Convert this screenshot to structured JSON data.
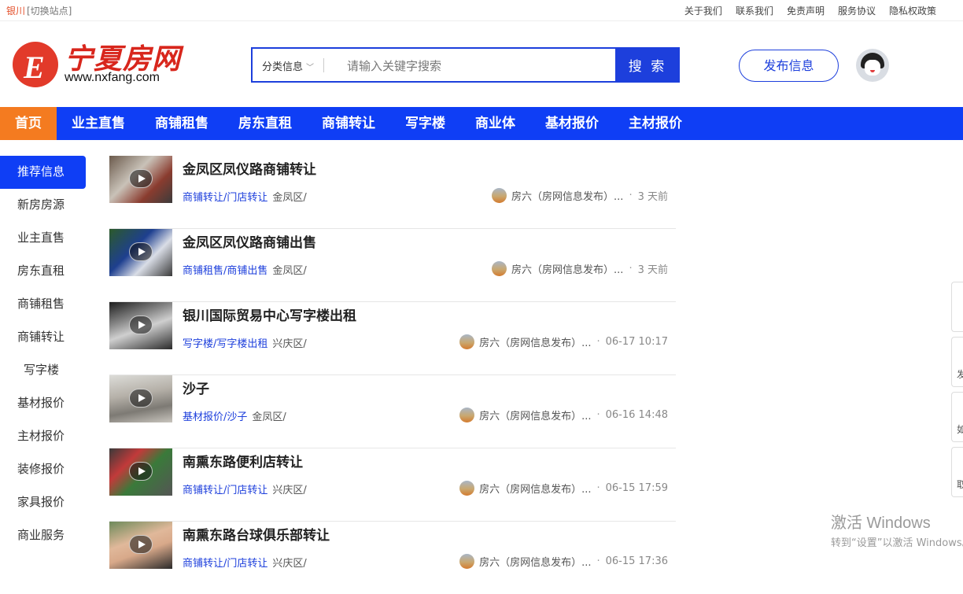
{
  "topbar": {
    "city": "银川",
    "switch": "[切换站点]",
    "links": [
      "关于我们",
      "联系我们",
      "免责声明",
      "服务协议",
      "隐私权政策"
    ]
  },
  "logo": {
    "title": "宁夏房网",
    "url": "www.nxfang.com",
    "mark": "E"
  },
  "search": {
    "category": "分类信息",
    "placeholder": "请输入关键字搜索",
    "button": "搜 索"
  },
  "header": {
    "publish": "发布信息"
  },
  "nav": [
    "首页",
    "业主直售",
    "商铺租售",
    "房东直租",
    "商铺转让",
    "写字楼",
    "商业体",
    "基材报价",
    "主材报价"
  ],
  "sidebar": [
    "推荐信息",
    "新房房源",
    "业主直售",
    "房东直租",
    "商铺租售",
    "商铺转让",
    "写字楼",
    "基材报价",
    "主材报价",
    "装修报价",
    "家具报价",
    "商业服务"
  ],
  "listings": [
    {
      "title": "金凤区凤仪路商铺转让",
      "tag": "商铺转让/门店转让",
      "district": "金凤区/",
      "author": "房六（房网信息发布）...",
      "time": "3 天前"
    },
    {
      "title": "金凤区凤仪路商铺出售",
      "tag": "商铺租售/商铺出售",
      "district": "金凤区/",
      "author": "房六（房网信息发布）...",
      "time": "3 天前"
    },
    {
      "title": "银川国际贸易中心写字楼出租",
      "tag": "写字楼/写字楼出租",
      "district": "兴庆区/",
      "author": "房六（房网信息发布）...",
      "time": "06-17 10:17"
    },
    {
      "title": "沙子",
      "tag": "基材报价/沙子",
      "district": "金凤区/",
      "author": "房六（房网信息发布）...",
      "time": "06-16 14:48"
    },
    {
      "title": "南熏东路便利店转让",
      "tag": "商铺转让/门店转让",
      "district": "兴庆区/",
      "author": "房六（房网信息发布）...",
      "time": "06-15 17:59"
    },
    {
      "title": "南熏东路台球俱乐部转让",
      "tag": "商铺转让/门店转让",
      "district": "兴庆区/",
      "author": "房六（房网信息发布）...",
      "time": "06-15 17:36"
    }
  ],
  "floats": [
    "发",
    "如",
    "取"
  ],
  "watermark": {
    "line1": "激活 Windows",
    "line2": "转到“设置”以激活 Windows。"
  }
}
